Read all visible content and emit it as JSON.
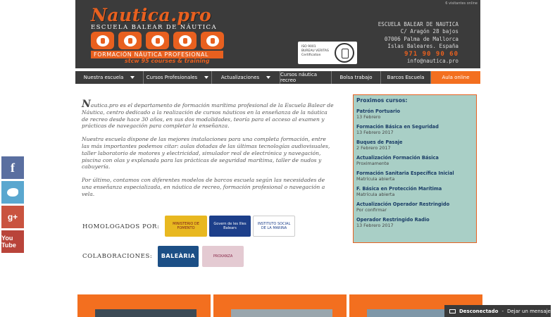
{
  "header": {
    "online_note": "6 visitantes online",
    "logo_title": "Nautica.pro",
    "logo_subtitle": "ESCUELA BALEAR DE NÁUTICA",
    "logo_tagline": "FORMACIÓN NÁUTICA PROFESIONAL",
    "logo_slogan": "stcw 95 courses & training",
    "cert_lines": [
      "ISO 9001",
      "BUREAU VERITAS",
      "Certification"
    ],
    "address": {
      "name": "ESCUELA BALEAR DE NAUTICA",
      "street": "C/ Aragón 28 bajos",
      "city": "07006 Palma de Mallorca",
      "region": "Islas Baleares. España",
      "phone": "971 90 90 60",
      "email": "info@nautica.pro"
    }
  },
  "nav": {
    "items": [
      {
        "label": "Nuestra escuela"
      },
      {
        "label": "Cursos Profesionales"
      },
      {
        "label": "Actualizaciones"
      },
      {
        "label": "Cursos náutica recreo"
      },
      {
        "label": "Bolsa trabajo"
      },
      {
        "label": "Barcos Escuela"
      },
      {
        "label": "Aula online"
      }
    ]
  },
  "intro": {
    "drop_letter": "N",
    "p1_rest": "autica.pro es el departamento de formación marítima profesional de la Escuela Balear de Náutica, centro dedicado a la realización de cursos náuticos en la enseñanza de la náutica de recreo desde hace 30 años, en sus dos modalidades, teoría para el acceso al examen y prácticas de navegación para completar la enseñanza.",
    "p2": "Nuestra escuela dispone de las mejores instalaciones para una completa formación, entre las más importantes podemos citar: aulas dotadas de las últimas tecnologías audiovisuales, taller laboratorio de motores y electricidad, simulador real de electrónica y navegación, piscina con olas y explanada para las prácticas de seguridad marítima, taller de nudos y cabuyería.",
    "p3": "Por último, contamos con diferentes modelos de barcos escuela según las necesidades de una enseñanza especializada, en náutica de recreo, formación profesional o navegación a vela."
  },
  "homologados": {
    "label": "HOMOLOGADOS POR:",
    "badges": [
      "MINISTERIO DE FOMENTO",
      "Govern de les Illes Balears",
      "INSTITUTO SOCIAL DE LA MARINA"
    ]
  },
  "colaboraciones": {
    "label": "COLABORACIONES:",
    "badges": [
      "BALEÀRIA",
      "PROXANZA"
    ]
  },
  "courses": {
    "title": "Proximos cursos:",
    "items": [
      {
        "name": "Patrón Portuario",
        "date": "13 Febrero"
      },
      {
        "name": "Formación Básica en Seguridad",
        "date": "13 Febrero 2017"
      },
      {
        "name": "Buques de Pasaje",
        "date": "2 Febrero 2017"
      },
      {
        "name": "Actualización Formación Básica",
        "date": "Proximamente"
      },
      {
        "name": "Formación Sanitaria Específica Inicial",
        "date": "Matrícula abierta"
      },
      {
        "name": "F. Básica en Protección Marítima",
        "date": "Matrícula abierta"
      },
      {
        "name": "Actualización Operador Restringido",
        "date": "Por confirmar"
      },
      {
        "name": "Operador Restringido Radio",
        "date": "13 Febrero 2017"
      }
    ]
  },
  "social": {
    "facebook": "f",
    "googleplus": "g+",
    "youtube": "You Tube"
  },
  "chat": {
    "status": "Desconectado",
    "sep": " - ",
    "action": "Dejar un mensaje"
  }
}
